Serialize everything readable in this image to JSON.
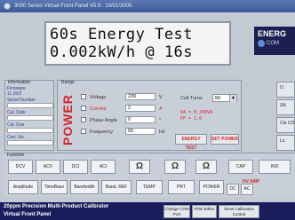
{
  "window": {
    "title": "3000 Series Virtual Front Panel V5.9 : 19/01/2005"
  },
  "display": {
    "line1": "60s Energy Test",
    "line2": "0.002kW/h @ 16s"
  },
  "energy_panel": {
    "header": "ENERG",
    "com_label": "COM"
  },
  "information": {
    "caption": "Information",
    "fields": [
      {
        "label": "Firmware",
        "value": "11.35/2"
      },
      {
        "label": "Serial Number",
        "value": ""
      },
      {
        "label": "Cal. Date",
        "value": ""
      },
      {
        "label": "Cal. Due",
        "value": ""
      },
      {
        "label": "Cert. No.",
        "value": ""
      }
    ]
  },
  "range": {
    "caption": "Range",
    "power_label": "POWER",
    "params": [
      {
        "label": "Voltage",
        "value": "230",
        "unit": "V",
        "highlight": false
      },
      {
        "label": "Current",
        "value": "2",
        "unit": "A",
        "highlight": true
      },
      {
        "label": "Phase Angle",
        "value": "0",
        "unit": "°",
        "highlight": false
      },
      {
        "label": "Frequency",
        "value": "50",
        "unit": "Hz",
        "highlight": false
      }
    ],
    "coil_turns_label": "Coil Turns",
    "coil_turns_value": "50",
    "va_readout": "VA = 0.200VA",
    "pf_readout": "PF = 1.0",
    "energy_test_button": "ENERGY TEST",
    "set_power_button": "SET POWER"
  },
  "side_buttons": [
    "O",
    "SA",
    "Cle COM",
    "Lo"
  ],
  "functions": {
    "caption": "Function",
    "row1": [
      "DCV",
      "ACV",
      "DCI",
      "ACI",
      "Ω",
      "Ω",
      "Ω",
      "CAP",
      "IND"
    ],
    "row2": [
      "Amplitude",
      "TimeBase",
      "Bandwidth",
      "Band. REF",
      "TEMP",
      "PRT",
      "POWER",
      "DC",
      "AC"
    ],
    "hv_amp_label": "HV AMP"
  },
  "statusbar": {
    "title_line1": "20ppm Precision Multi-Product Calibrator",
    "title_line2": "Virtual Front Panel",
    "buttons": [
      "Change COM Port",
      "POD Editor",
      "Show Calibration Control"
    ]
  }
}
